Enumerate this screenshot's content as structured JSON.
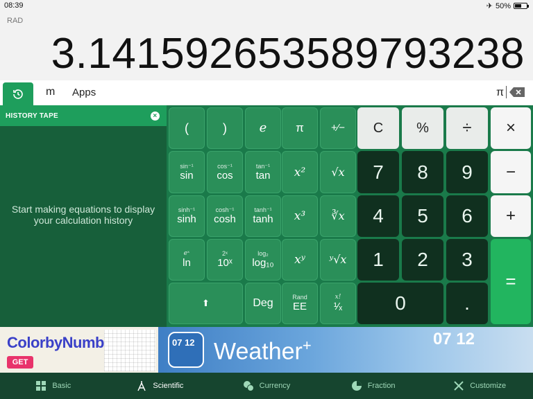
{
  "status": {
    "time": "08:39",
    "battery": "50%"
  },
  "display": {
    "mode": "RAD",
    "result": "3.14159265358979323 8"
  },
  "tabs": {
    "m_label": "m",
    "apps_label": "Apps",
    "expression": "π"
  },
  "history": {
    "title": "HISTORY TAPE",
    "empty_text": "Start making equations to display your calculation history"
  },
  "keys": {
    "row1": [
      "(",
      ")",
      "e",
      "π",
      "+⁄−"
    ],
    "sin": {
      "sup": "sin⁻¹",
      "main": "sin"
    },
    "cos": {
      "sup": "cos⁻¹",
      "main": "cos"
    },
    "tan": {
      "sup": "tan⁻¹",
      "main": "tan"
    },
    "sinh": {
      "sup": "sinh⁻¹",
      "main": "sinh"
    },
    "cosh": {
      "sup": "cosh⁻¹",
      "main": "cosh"
    },
    "tanh": {
      "sup": "tanh⁻¹",
      "main": "tanh"
    },
    "ln": {
      "sup": "eˣ",
      "main": "ln"
    },
    "log10": {
      "sup": "2ˣ",
      "main": "10ˣ"
    },
    "log2": {
      "sup": "log₂",
      "main": "log₁₀"
    },
    "x2": "x²",
    "sqrt": "√x",
    "x3": "x³",
    "cbrt": "∛x",
    "xy": "xʸ",
    "yroot": "ʸ√x",
    "shift": "⬆",
    "deg": "Deg",
    "rand": {
      "sup": "Rand",
      "main": "EE"
    },
    "fact": {
      "sup": "x!",
      "main": "¹⁄ₓ"
    },
    "clear": "C",
    "percent": "%",
    "divide": "÷",
    "multiply": "×",
    "minus": "−",
    "plus": "+",
    "equals": "=",
    "decimal": ".",
    "digits": [
      "0",
      "1",
      "2",
      "3",
      "4",
      "5",
      "6",
      "7",
      "8",
      "9"
    ]
  },
  "ad": {
    "left_title": "ColorbyNumber",
    "get": "GET",
    "weather": "Weather",
    "weather_plus": "+",
    "icon_time": "07 12",
    "clock": "07 12"
  },
  "bottom_nav": [
    {
      "label": "Basic",
      "icon": "grid-icon"
    },
    {
      "label": "Scientific",
      "icon": "compass-icon"
    },
    {
      "label": "Currency",
      "icon": "currency-icon"
    },
    {
      "label": "Fraction",
      "icon": "pie-icon"
    },
    {
      "label": "Customize",
      "icon": "tools-icon"
    }
  ],
  "colors": {
    "accent": "#1e9e5c",
    "keypad": "#1a7a4a",
    "equals": "#22b55f"
  }
}
